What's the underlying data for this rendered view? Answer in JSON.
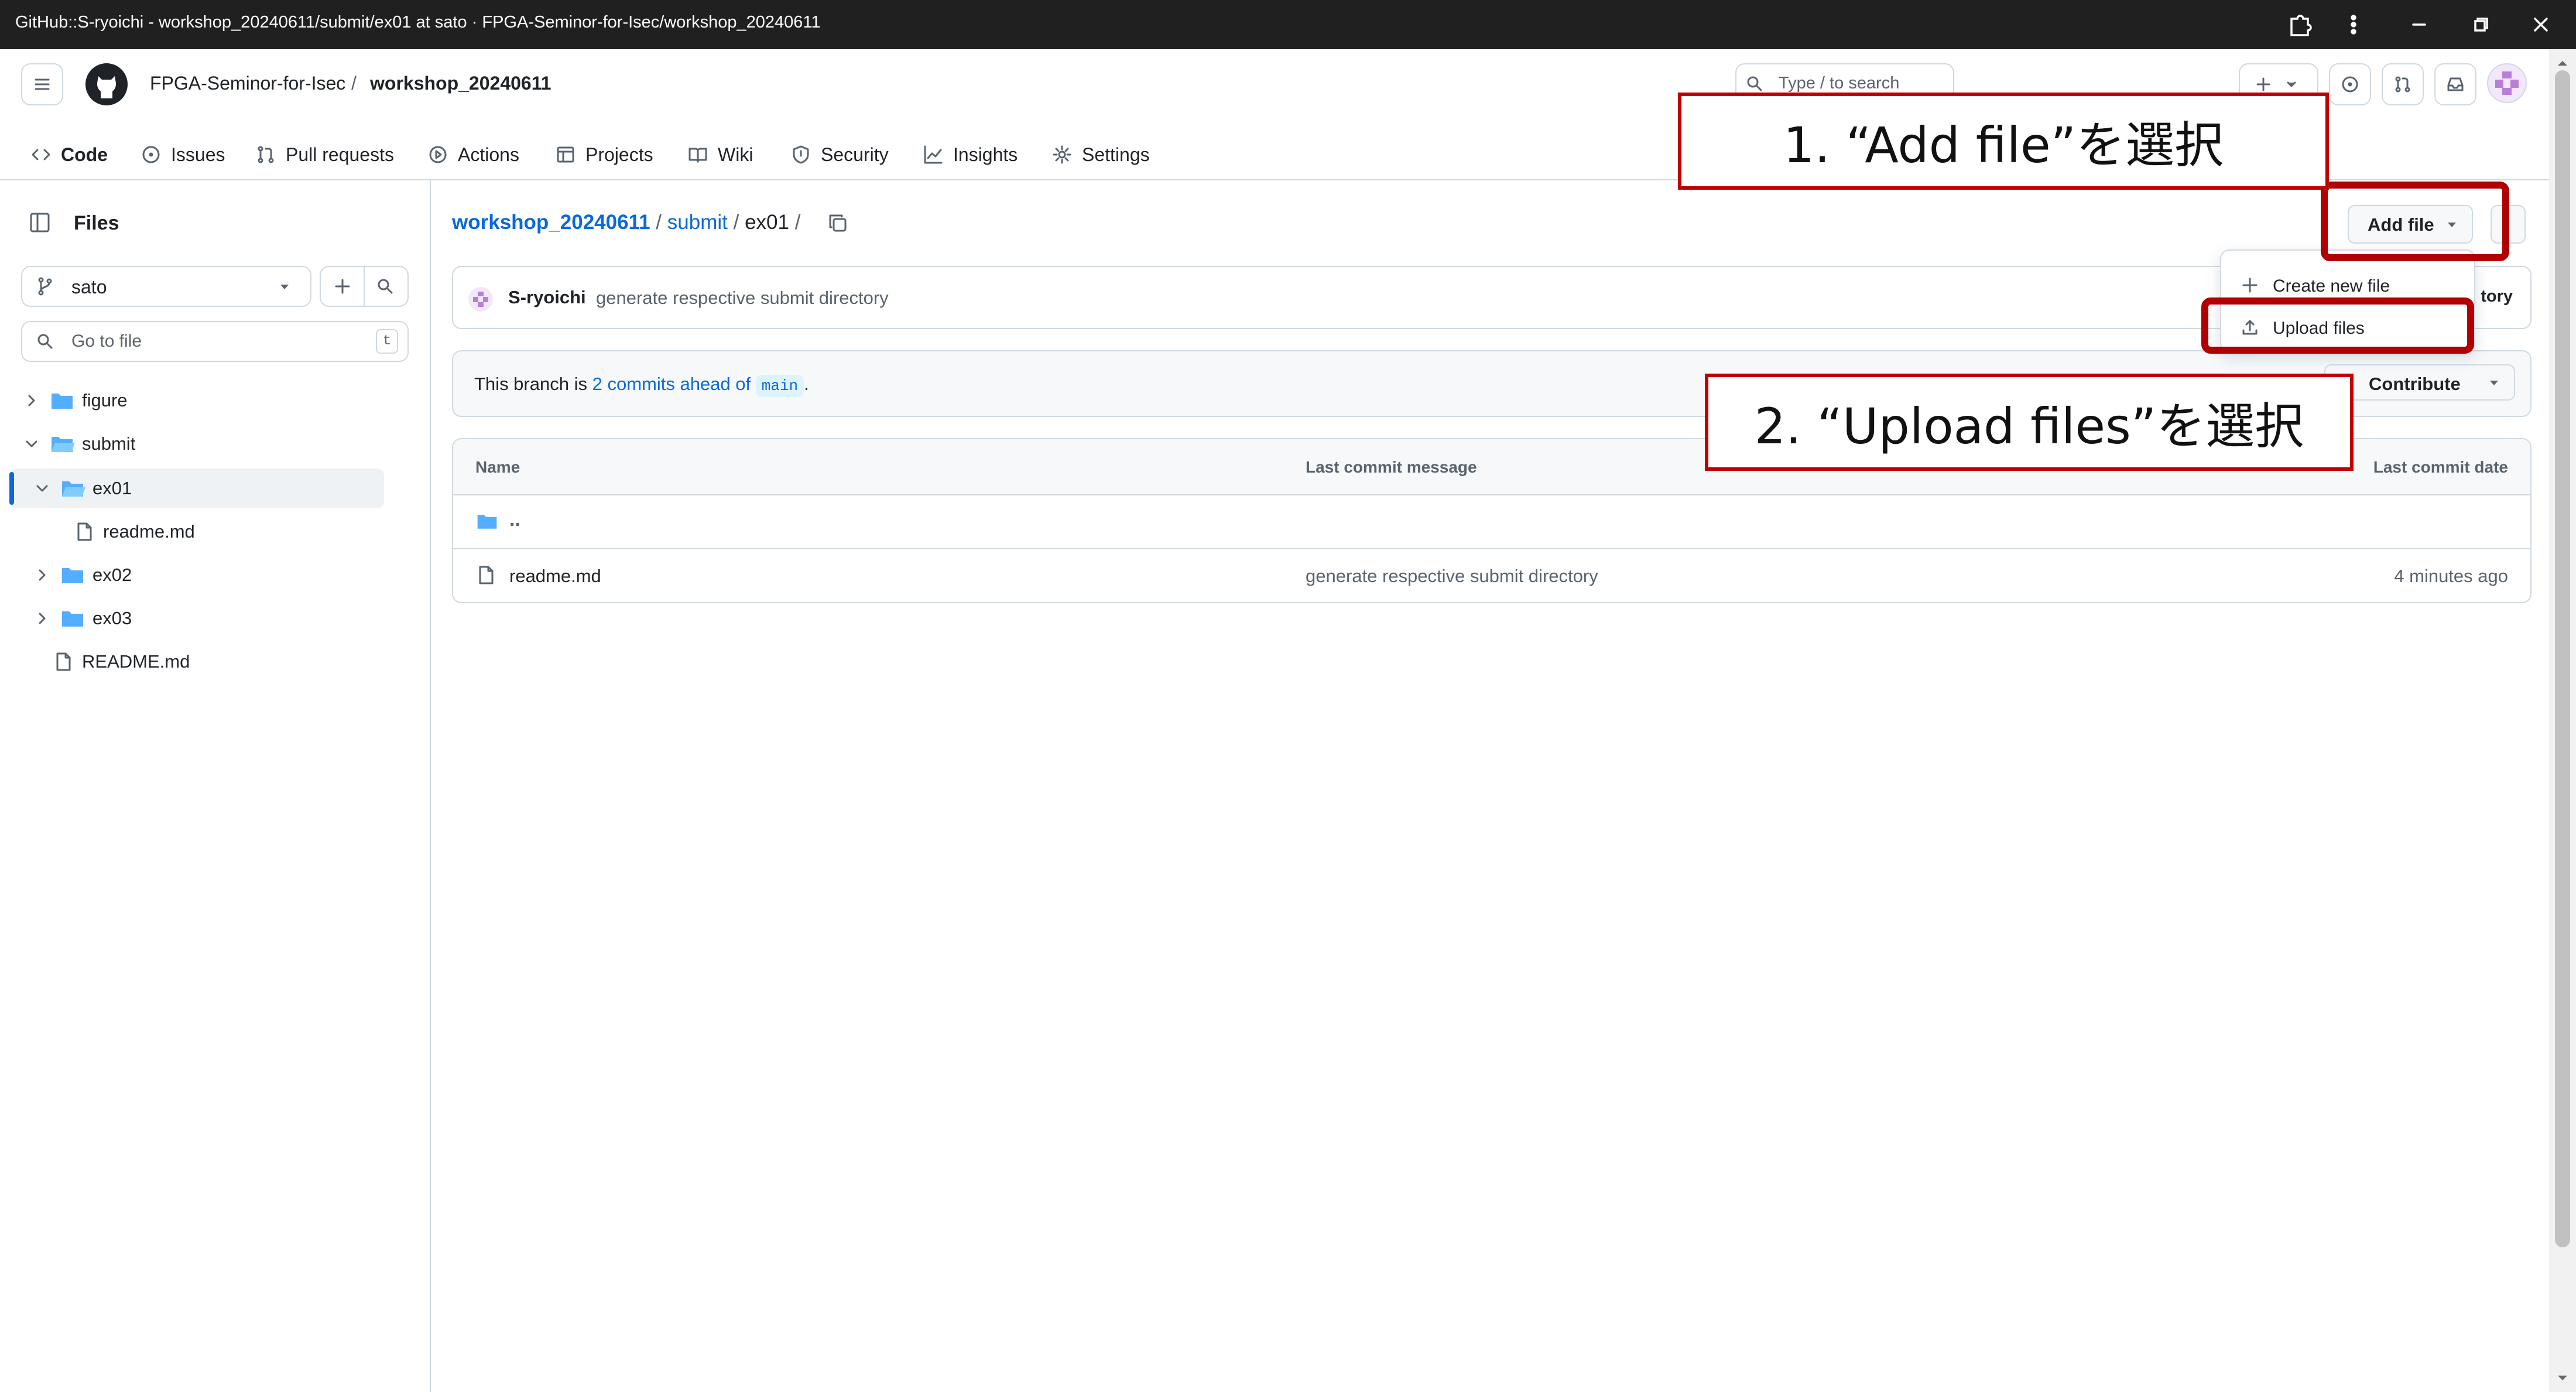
{
  "window": {
    "title": "GitHub::S-ryoichi - workshop_20240611/submit/ex01 at sato · FPGA-Seminor-for-Isec/workshop_20240611"
  },
  "header": {
    "owner": "FPGA-Seminor-for-Isec",
    "separator": "/",
    "repo": "workshop_20240611",
    "search_placeholder": "Type / to search",
    "tabs": [
      {
        "label": "Code",
        "icon": "code-icon"
      },
      {
        "label": "Issues",
        "icon": "issue-icon"
      },
      {
        "label": "Pull requests",
        "icon": "pull-request-icon"
      },
      {
        "label": "Actions",
        "icon": "play-icon"
      },
      {
        "label": "Projects",
        "icon": "table-icon"
      },
      {
        "label": "Wiki",
        "icon": "book-icon"
      },
      {
        "label": "Security",
        "icon": "shield-icon"
      },
      {
        "label": "Insights",
        "icon": "graph-icon"
      },
      {
        "label": "Settings",
        "icon": "gear-icon"
      }
    ]
  },
  "sidebar": {
    "title": "Files",
    "branch": "sato",
    "go_to_file_placeholder": "Go to file",
    "shortcut_key": "t",
    "tree": [
      {
        "label": "figure",
        "type": "folder",
        "expanded": false
      },
      {
        "label": "submit",
        "type": "folder",
        "expanded": true
      },
      {
        "label": "ex01",
        "type": "folder",
        "expanded": true,
        "selected": true
      },
      {
        "label": "readme.md",
        "type": "file"
      },
      {
        "label": "ex02",
        "type": "folder",
        "expanded": false
      },
      {
        "label": "ex03",
        "type": "folder",
        "expanded": false
      },
      {
        "label": "README.md",
        "type": "file"
      }
    ]
  },
  "main": {
    "breadcrumb": {
      "repo": "workshop_20240611",
      "dir": "submit",
      "current": "ex01",
      "sep": "/"
    },
    "add_file_label": "Add file",
    "latest_commit": {
      "author": "S-ryoichi",
      "message": "generate respective submit directory",
      "history_fragment": "tory"
    },
    "branch_notice": {
      "prefix": "This branch is",
      "link": "2 commits ahead of",
      "branch": "main",
      "suffix": "."
    },
    "contribute_label": "Contribute",
    "dropdown": {
      "items": [
        "Create new file",
        "Upload files"
      ]
    },
    "table": {
      "headers": [
        "Name",
        "Last commit message",
        "Last commit date"
      ],
      "parent_row": "..",
      "rows": [
        {
          "name": "readme.md",
          "message": "generate respective submit directory",
          "date": "4 minutes ago"
        }
      ]
    }
  },
  "annotations": {
    "step1": "1. “Add file”を選択",
    "step2": "2. “Upload files”を選択"
  },
  "colors": {
    "accent": "#0969da",
    "annotation_red": "#c00000",
    "folder": "#54aeff",
    "avatar": "#b87fd9"
  }
}
